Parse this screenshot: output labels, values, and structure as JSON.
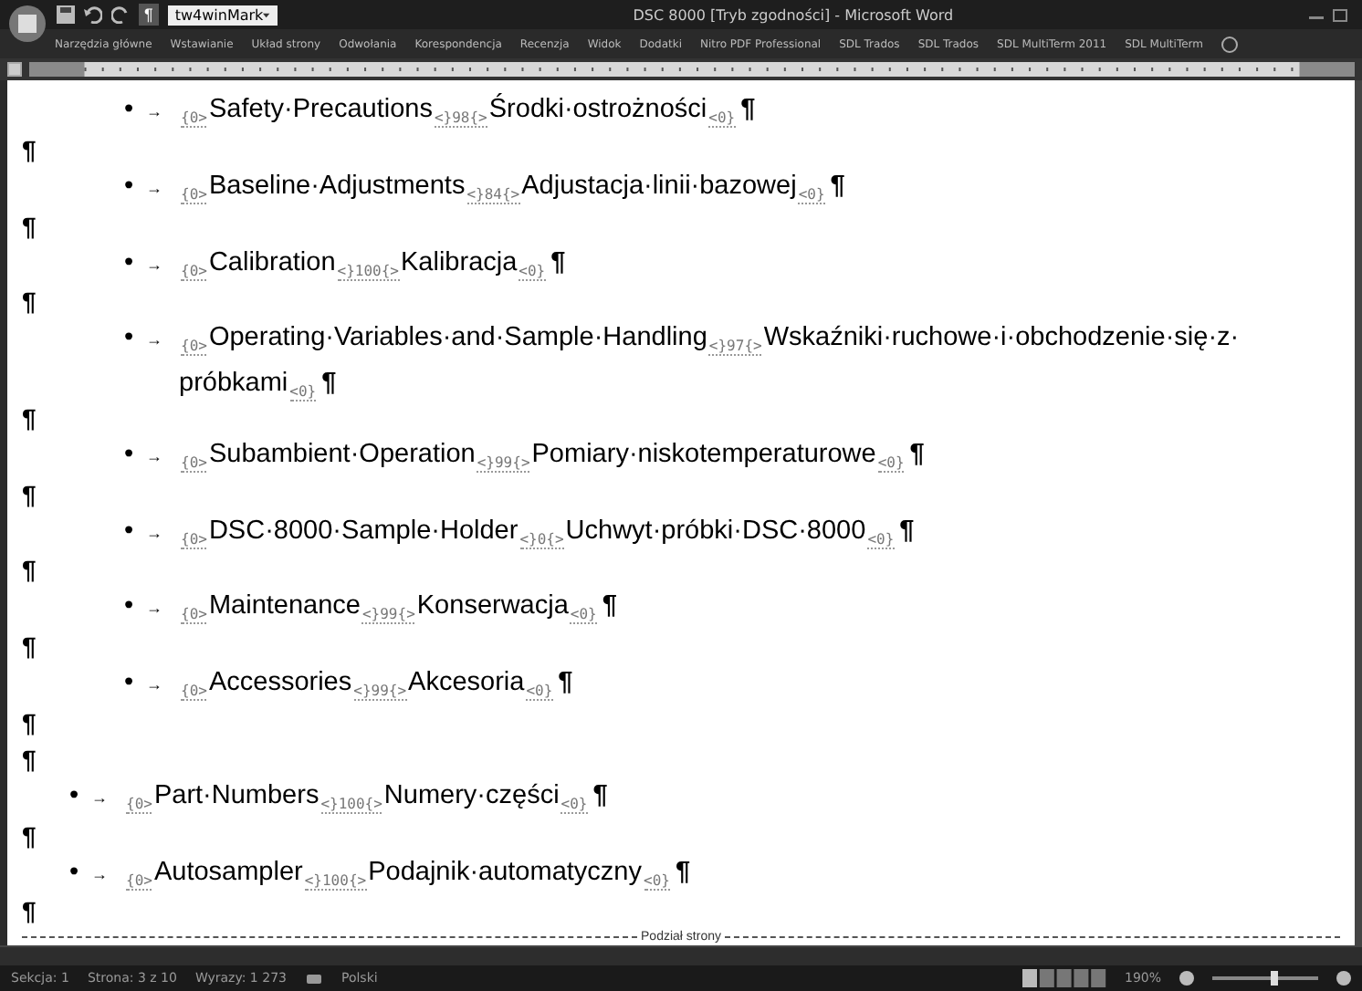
{
  "window": {
    "title": "DSC 8000 [Tryb zgodności] - Microsoft Word",
    "style_box": "tw4winMark",
    "pilcrow": "¶"
  },
  "ribbon_tabs": [
    "Narzędzia główne",
    "Wstawianie",
    "Układ strony",
    "Odwołania",
    "Korespondencja",
    "Recenzja",
    "Widok",
    "Dodatki",
    "Nitro PDF Professional",
    "SDL Trados",
    "SDL Trados",
    "SDL MultiTerm 2011",
    "SDL MultiTerm"
  ],
  "document": {
    "paragraphs": [
      {
        "kind": "nested_bullet",
        "bullet": "•",
        "tab": "→",
        "open": "{0>",
        "source": "Safety·Precautions",
        "mid": "<}98{>",
        "target": "Środki·ostrożności",
        "close": "<0}",
        "mark": "¶"
      },
      {
        "kind": "empty",
        "mark": "¶"
      },
      {
        "kind": "nested_bullet",
        "bullet": "•",
        "tab": "→",
        "open": "{0>",
        "source": "Baseline·Adjustments",
        "mid": "<}84{>",
        "target": "Adjustacja·linii·bazowej",
        "close": "<0}",
        "mark": "¶"
      },
      {
        "kind": "empty",
        "mark": "¶"
      },
      {
        "kind": "nested_bullet",
        "bullet": "•",
        "tab": "→",
        "open": "{0>",
        "source": "Calibration",
        "mid": "<}100{>",
        "target": "Kalibracja",
        "close": "<0}",
        "mark": "¶"
      },
      {
        "kind": "empty",
        "mark": "¶"
      },
      {
        "kind": "nested_bullet",
        "bullet": "•",
        "tab": "→",
        "open": "{0>",
        "source": "Operating·Variables·and·Sample·Handling",
        "mid": "<}97{>",
        "target": "Wskaźniki·ruchowe·i·obchodzenie·się·z·",
        "target_wrap": "próbkami",
        "close": "<0}",
        "mark": "¶"
      },
      {
        "kind": "empty",
        "mark": "¶"
      },
      {
        "kind": "nested_bullet",
        "bullet": "•",
        "tab": "→",
        "open": "{0>",
        "source": "Subambient·Operation",
        "mid": "<}99{>",
        "target": "Pomiary·niskotemperaturowe",
        "close": "<0}",
        "mark": "¶"
      },
      {
        "kind": "empty",
        "mark": "¶"
      },
      {
        "kind": "nested_bullet",
        "bullet": "•",
        "tab": "→",
        "open": "{0>",
        "source": "DSC·8000·Sample·Holder",
        "mid": "<}0{>",
        "target": "Uchwyt·próbki·DSC·8000",
        "close": "<0}",
        "mark": "¶"
      },
      {
        "kind": "empty",
        "mark": "¶"
      },
      {
        "kind": "nested_bullet",
        "bullet": "•",
        "tab": "→",
        "open": "{0>",
        "source": "Maintenance",
        "mid": "<}99{>",
        "target": "Konserwacja",
        "close": "<0}",
        "mark": "¶"
      },
      {
        "kind": "empty",
        "mark": "¶"
      },
      {
        "kind": "nested_bullet",
        "bullet": "•",
        "tab": "→",
        "open": "{0>",
        "source": "Accessories",
        "mid": "<}99{>",
        "target": "Akcesoria",
        "close": "<0}",
        "mark": "¶"
      },
      {
        "kind": "empty",
        "mark": "¶"
      },
      {
        "kind": "empty",
        "mark": "¶"
      },
      {
        "kind": "bullet",
        "bullet": "•",
        "tab": "→",
        "open": "{0>",
        "source": "Part·Numbers",
        "mid": "<}100{>",
        "target": "Numery·części",
        "close": "<0}",
        "mark": "¶"
      },
      {
        "kind": "empty",
        "mark": "¶"
      },
      {
        "kind": "bullet",
        "bullet": "•",
        "tab": "→",
        "open": "{0>",
        "source": "Autosampler",
        "mid": "<}100{>",
        "target": "Podajnik·automatyczny",
        "close": "<0}",
        "mark": "¶"
      },
      {
        "kind": "empty",
        "mark": "¶"
      }
    ],
    "page_break": "Podział strony"
  },
  "status_bar": {
    "items": [
      "Sekcja: 1",
      "Strona: 3 z 10",
      "Wyrazy: 1 273"
    ],
    "language": "Polski",
    "zoom": "190%",
    "zoom_slider": {
      "level": 0.58
    }
  }
}
